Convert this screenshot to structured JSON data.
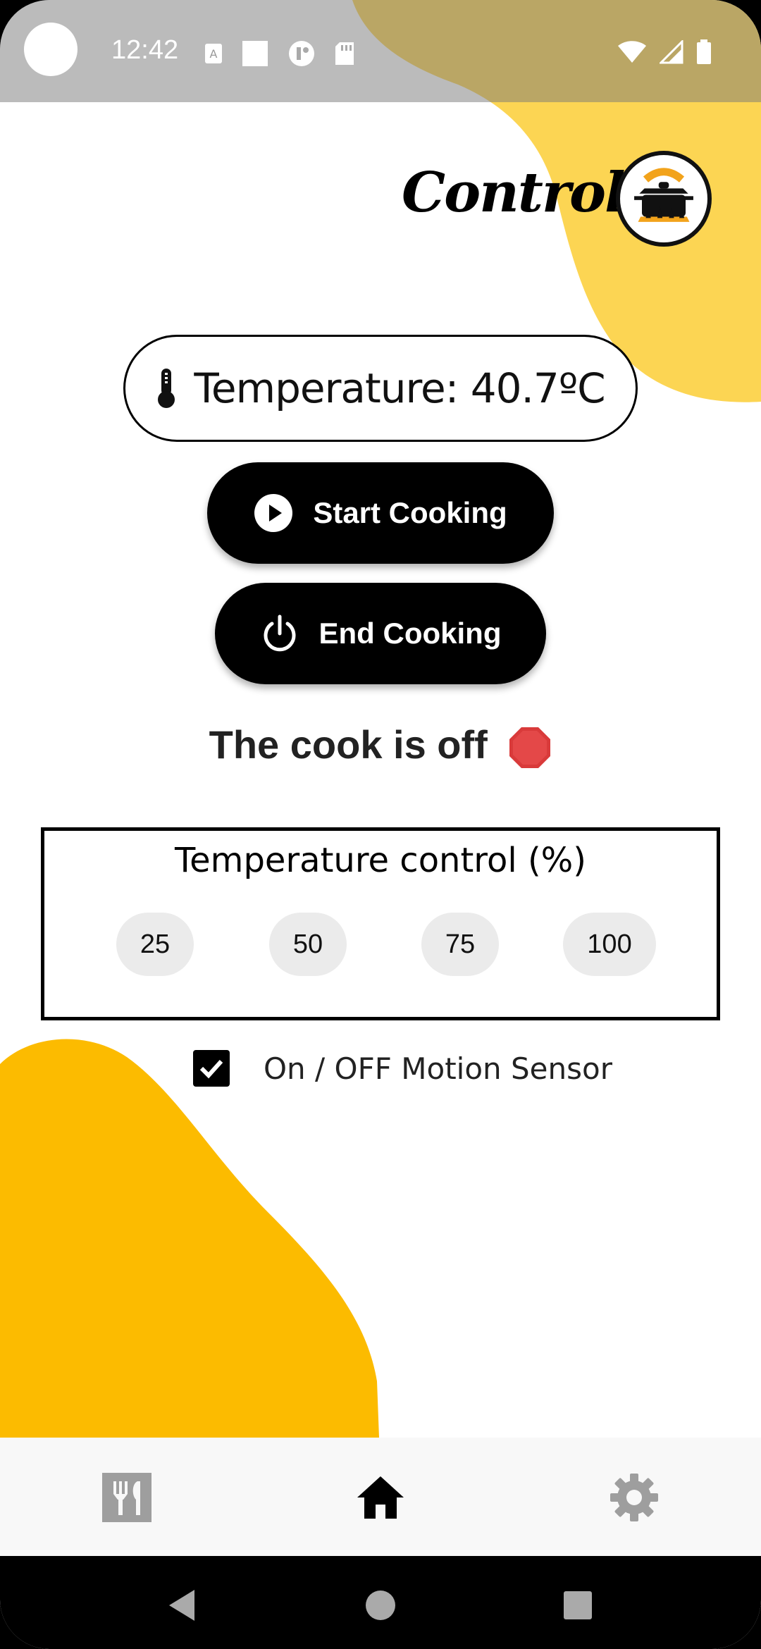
{
  "status_bar": {
    "time": "12:42"
  },
  "header": {
    "title": "Control"
  },
  "temperature": {
    "label": "Temperature: 40.7ºC"
  },
  "actions": {
    "start_label": "Start Cooking",
    "end_label": "End Cooking"
  },
  "cook_status": {
    "text": "The cook is off"
  },
  "temperature_control": {
    "title": "Temperature control (%)",
    "options": [
      "25",
      "50",
      "75",
      "100"
    ]
  },
  "motion_sensor": {
    "label": "On / OFF Motion Sensor",
    "checked": true
  },
  "bottom_nav": {
    "items": [
      "dining-icon",
      "home-icon",
      "settings-icon"
    ],
    "active": "home-icon"
  },
  "colors": {
    "accent_yellow": "#FCBB00",
    "light_yellow": "#FCD553",
    "primary": "#000000",
    "chip_bg": "#EBEBEB"
  }
}
